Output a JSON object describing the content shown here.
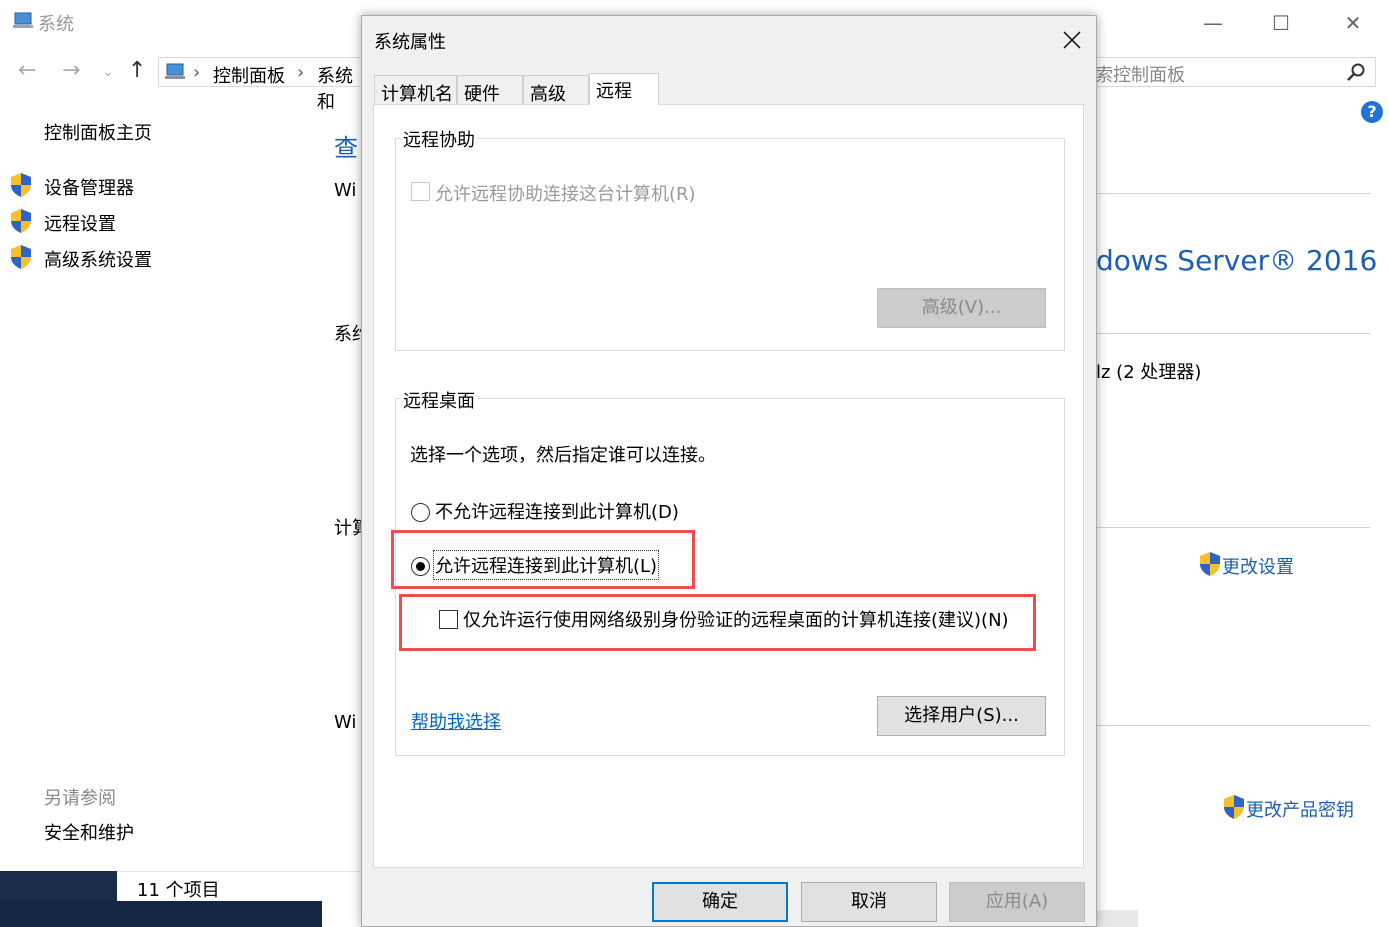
{
  "bg": {
    "title": "系统",
    "breadcrumb": [
      "控制面板",
      "系统和"
    ],
    "search_placeholder": "搜索控制面板",
    "search_visible": "索控制面板",
    "sidebar": {
      "home": "控制面板主页",
      "items": [
        "设备管理器",
        "远程设置",
        "高级系统设置"
      ],
      "see_also": "另请参阅",
      "security": "安全和维护"
    },
    "status": "11 个项目",
    "fragments": {
      "heading": "查",
      "win1": "Wi",
      "sys": "系约",
      "comp": "计算",
      "win2": "Wi"
    },
    "right": {
      "edition": "dows Server® 2016",
      "processor": "lz  (2 处理器)",
      "change_settings": "更改设置",
      "change_key": "更改产品密钥"
    }
  },
  "dialog": {
    "title": "系统属性",
    "tabs": [
      "计算机名",
      "硬件",
      "高级",
      "远程"
    ],
    "active_tab": 3,
    "remote_assist": {
      "label": "远程协助",
      "checkbox": "允许远程协助连接这台计算机(R)",
      "checked": false,
      "enabled": false,
      "advanced_btn": "高级(V)..."
    },
    "remote_desktop": {
      "label": "远程桌面",
      "instruction": "选择一个选项，然后指定谁可以连接。",
      "options": [
        {
          "label": "不允许远程连接到此计算机(D)",
          "selected": false
        },
        {
          "label": "允许远程连接到此计算机(L)",
          "selected": true
        }
      ],
      "nla_checkbox": "仅允许运行使用网络级别身份验证的远程桌面的计算机连接(建议)(N)",
      "nla_checked": false,
      "help_link": "帮助我选择",
      "select_users_btn": "选择用户(S)..."
    },
    "buttons": {
      "ok": "确定",
      "cancel": "取消",
      "apply": "应用(A)"
    },
    "highlight_color": "#f04e4e"
  }
}
